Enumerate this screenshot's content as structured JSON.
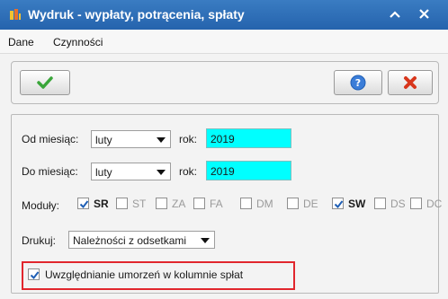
{
  "window": {
    "title": "Wydruk - wypłaty, potrącenia, spłaty",
    "collapse_glyph": "⌃",
    "close_glyph": "✕"
  },
  "menu": [
    "Dane",
    "Czynności"
  ],
  "toolbar": {
    "ok_icon": "checkmark-icon",
    "help_icon": "help-icon",
    "cancel_icon": "cross-icon"
  },
  "form": {
    "from_month_label": "Od miesiąc:",
    "from_month_value": "luty",
    "from_year_label": "rok:",
    "from_year_value": "2019",
    "to_month_label": "Do miesiąc:",
    "to_month_value": "luty",
    "to_year_label": "rok:",
    "to_year_value": "2019",
    "modules_label": "Moduły:",
    "modules": [
      {
        "code": "SR",
        "checked": true
      },
      {
        "code": "ST",
        "checked": false
      },
      {
        "code": "ZA",
        "checked": false
      },
      {
        "code": "FA",
        "checked": false
      },
      {
        "code": "DM",
        "checked": false
      },
      {
        "code": "DE",
        "checked": false
      },
      {
        "code": "SW",
        "checked": true
      },
      {
        "code": "DS",
        "checked": false
      },
      {
        "code": "DC",
        "checked": false
      }
    ],
    "print_label": "Drukuj:",
    "print_value": "Należności z odsetkami",
    "include_writeoffs_label": "Uwzględnianie umorzeń w kolumnie spłat",
    "include_writeoffs_checked": true
  },
  "colors": {
    "titlebar": "#2d6fb8",
    "year_field": "#00ffff",
    "highlight": "#e1262d",
    "check_green": "#3aa63a",
    "check_blue": "#1f5fb5",
    "cancel_red": "#d8361c"
  }
}
